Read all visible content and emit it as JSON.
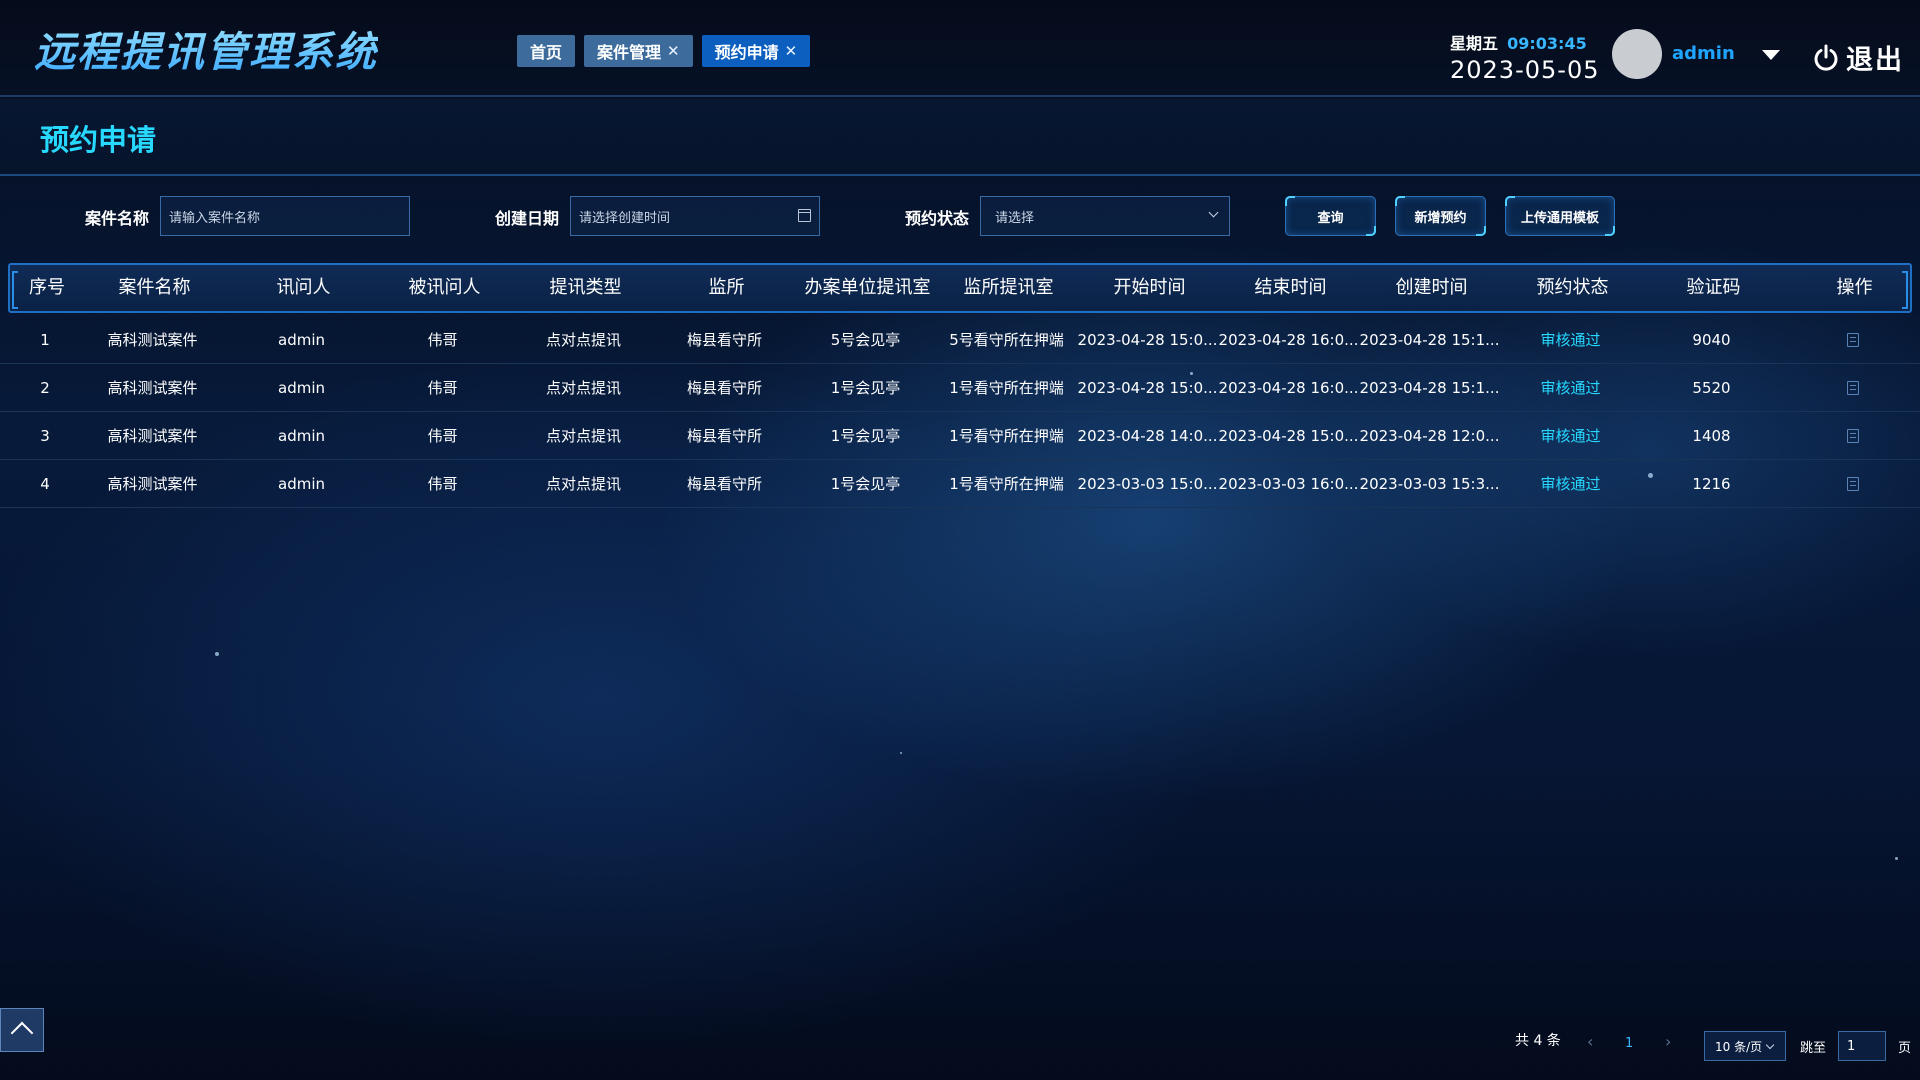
{
  "header": {
    "app_title": "远程提讯管理系统",
    "tabs": [
      {
        "label": "首页",
        "closable": false,
        "active": false
      },
      {
        "label": "案件管理",
        "closable": true,
        "active": false
      },
      {
        "label": "预约申请",
        "closable": true,
        "active": true
      }
    ],
    "close_glyph": "✕",
    "weekday": "星期五",
    "time": "09:03:45",
    "date": "2023-05-05",
    "username": "admin",
    "logout_label": "退出"
  },
  "page": {
    "title": "预约申请"
  },
  "filters": {
    "case_name_label": "案件名称",
    "case_name_placeholder": "请输入案件名称",
    "created_date_label": "创建日期",
    "created_date_placeholder": "请选择创建时间",
    "status_label": "预约状态",
    "status_placeholder": "请选择",
    "query_button": "查询",
    "add_button": "新增预约",
    "upload_button": "上传通用模板"
  },
  "table": {
    "columns": [
      "序号",
      "案件名称",
      "讯问人",
      "被讯问人",
      "提讯类型",
      "监所",
      "办案单位提讯室",
      "监所提讯室",
      "开始时间",
      "结束时间",
      "创建时间",
      "预约状态",
      "验证码",
      "操作"
    ],
    "rows": [
      [
        "1",
        "高科测试案件",
        "admin",
        "伟哥",
        "点对点提讯",
        "梅县看守所",
        "5号会见亭",
        "5号看守所在押端",
        "2023-04-28 15:0...",
        "2023-04-28 16:0...",
        "2023-04-28 15:1...",
        "审核通过",
        "9040"
      ],
      [
        "2",
        "高科测试案件",
        "admin",
        "伟哥",
        "点对点提讯",
        "梅县看守所",
        "1号会见亭",
        "1号看守所在押端",
        "2023-04-28 15:0...",
        "2023-04-28 16:0...",
        "2023-04-28 15:1...",
        "审核通过",
        "5520"
      ],
      [
        "3",
        "高科测试案件",
        "admin",
        "伟哥",
        "点对点提讯",
        "梅县看守所",
        "1号会见亭",
        "1号看守所在押端",
        "2023-04-28 14:0...",
        "2023-04-28 15:0...",
        "2023-04-28 12:0...",
        "审核通过",
        "1408"
      ],
      [
        "4",
        "高科测试案件",
        "admin",
        "伟哥",
        "点对点提讯",
        "梅县看守所",
        "1号会见亭",
        "1号看守所在押端",
        "2023-03-03 15:0...",
        "2023-03-03 16:0...",
        "2023-03-03 15:3...",
        "审核通过",
        "1216"
      ]
    ],
    "operation_icon": "document-icon"
  },
  "pagination": {
    "total_text": "共 4 条",
    "prev_glyph": "‹",
    "current_page": "1",
    "next_glyph": "›",
    "page_size": "10 条/页",
    "jump_label": "跳至",
    "jump_value": "1",
    "page_suffix": "页"
  },
  "colors": {
    "accent": "#27d9ff",
    "active_tab": "#0d5fbf",
    "border": "#1f6fc4"
  }
}
